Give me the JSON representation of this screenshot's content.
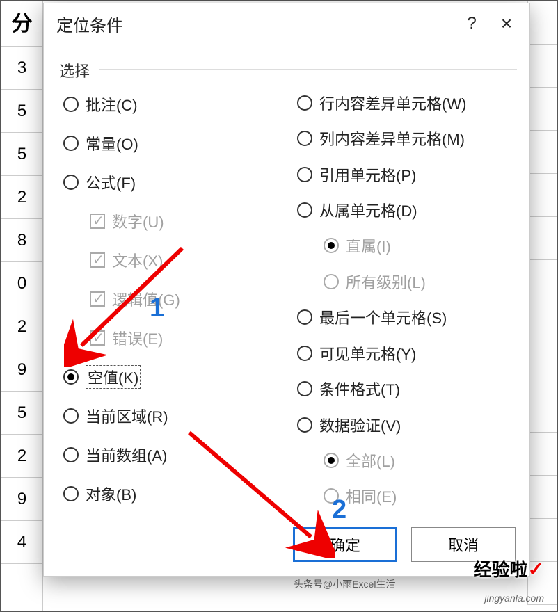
{
  "dialog": {
    "title": "定位条件",
    "help": "?",
    "close": "×",
    "group_label": "选择",
    "ok": "确定",
    "cancel": "取消"
  },
  "left": {
    "comments": "批注(C)",
    "constants": "常量(O)",
    "formulas": "公式(F)",
    "cb_numbers": "数字(U)",
    "cb_text": "文本(X)",
    "cb_logical": "逻辑值(G)",
    "cb_errors": "错误(E)",
    "blanks": "空值(K)",
    "current_region": "当前区域(R)",
    "current_array": "当前数组(A)",
    "objects": "对象(B)"
  },
  "right": {
    "row_diff": "行内容差异单元格(W)",
    "col_diff": "列内容差异单元格(M)",
    "precedents": "引用单元格(P)",
    "dependents": "从属单元格(D)",
    "direct": "直属(I)",
    "all_levels": "所有级别(L)",
    "last_cell": "最后一个单元格(S)",
    "visible": "可见单元格(Y)",
    "cond_fmt": "条件格式(T)",
    "data_valid": "数据验证(V)",
    "all": "全部(L)",
    "same": "相同(E)"
  },
  "anno": {
    "n1": "1",
    "n2": "2"
  },
  "sheet": {
    "header": "分",
    "rows": [
      "3",
      "5",
      "5",
      "2",
      "8",
      "0",
      "2",
      "9",
      "5",
      "2",
      "9",
      "4"
    ]
  },
  "watermark": {
    "brand": "经验啦",
    "author": "头条号@小雨Excel生活",
    "site": "jingyanla.com"
  }
}
